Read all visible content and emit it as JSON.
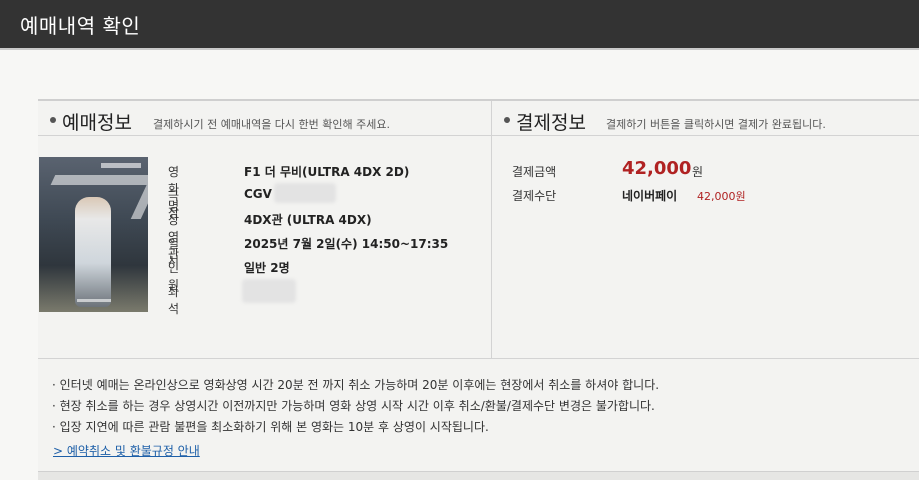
{
  "page": {
    "title": "예매내역 확인"
  },
  "reservation": {
    "heading": "예매정보",
    "description": "결제하시기 전 예매내역을 다시 한번 확인해 주세요.",
    "fields": {
      "movie": {
        "label": "영화명",
        "value": "F1 더 무비(ULTRA 4DX 2D)"
      },
      "theater": {
        "label": "극장",
        "value": "CGV"
      },
      "screen": {
        "label": "상영관",
        "value": "4DX관 (ULTRA 4DX)"
      },
      "datetime": {
        "label": "일시",
        "value": "2025년 7월 2일(수) 14:50~17:35"
      },
      "people": {
        "label": "인원",
        "value": "일반 2명"
      },
      "seat": {
        "label": "좌석",
        "value": ""
      }
    }
  },
  "payment": {
    "heading": "결제정보",
    "description": "결제하기 버튼을 클릭하시면 결제가 완료됩니다.",
    "amount": {
      "label": "결제금액",
      "value": "42,000",
      "unit": "원"
    },
    "method": {
      "label": "결제수단",
      "value": "네이버페이",
      "amount": "42,000원"
    }
  },
  "notices": [
    "· 인터넷 예매는 온라인상으로 영화상영 시간 20분 전 까지 취소 가능하며 20분 이후에는 현장에서 취소를 하셔야 합니다.",
    "· 현장 취소를 하는 경우 상영시간 이전까지만 가능하며 영화 상영 시작 시간 이후 취소/환불/결제수단 변경은 불가합니다.",
    "· 입장 지연에 따른 관람 불편을 최소화하기 위해 본 영화는 10분 후 상영이 시작됩니다."
  ],
  "refund_link": "> 예약취소 및 환불규정 안내",
  "colors": {
    "accent_red": "#b02222",
    "link_blue": "#1d5fa8",
    "header_bg": "#333333"
  }
}
